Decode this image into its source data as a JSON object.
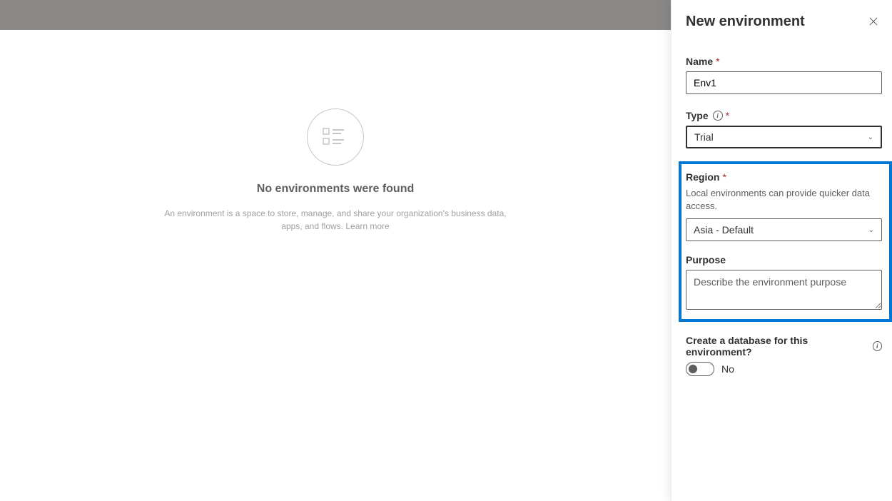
{
  "emptyState": {
    "title": "No environments were found",
    "description": "An environment is a space to store, manage, and share your organization's business data, apps, and flows. ",
    "learnMore": "Learn more"
  },
  "panel": {
    "title": "New environment",
    "fields": {
      "name": {
        "label": "Name",
        "value": "Env1"
      },
      "type": {
        "label": "Type",
        "value": "Trial"
      },
      "region": {
        "label": "Region",
        "help": "Local environments can provide quicker data access.",
        "value": "Asia - Default"
      },
      "purpose": {
        "label": "Purpose",
        "placeholder": "Describe the environment purpose"
      },
      "database": {
        "label": "Create a database for this environment?",
        "value": "No"
      }
    },
    "requiredMark": "*"
  }
}
